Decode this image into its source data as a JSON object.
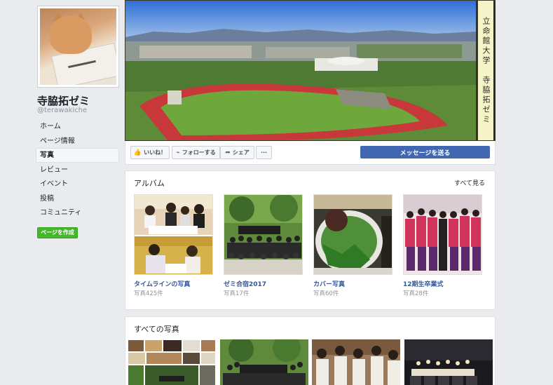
{
  "profile": {
    "name": "寺脇拓ゼミ",
    "handle": "@terawakiche"
  },
  "sidebar": {
    "items": [
      {
        "label": "ホーム",
        "active": false
      },
      {
        "label": "ページ情報",
        "active": false
      },
      {
        "label": "写真",
        "active": true
      },
      {
        "label": "レビュー",
        "active": false
      },
      {
        "label": "イベント",
        "active": false
      },
      {
        "label": "投稿",
        "active": false
      },
      {
        "label": "コミュニティ",
        "active": false
      }
    ],
    "create_page_label": "ページを作成"
  },
  "cover": {
    "sign_text": "立命館大学　寺脇拓ゼミ"
  },
  "actions": {
    "like_label": "いいね！",
    "follow_label": "フォローする",
    "share_label": "シェア",
    "more_label": "···",
    "message_label": "メッセージを送る"
  },
  "albums_section": {
    "title": "アルバム",
    "see_all": "すべて見る",
    "albums": [
      {
        "name": "タイムラインの写真",
        "count": "写真425件"
      },
      {
        "name": "ゼミ合宿2017",
        "count": "写真17件"
      },
      {
        "name": "カバー写真",
        "count": "写真60件"
      },
      {
        "name": "12期生卒業式",
        "count": "写真28件"
      }
    ]
  },
  "photos_section": {
    "title": "すべての写真"
  },
  "colors": {
    "page_bg": "#e9ebee",
    "link": "#365899",
    "primary": "#4267b2",
    "create": "#42b72a"
  }
}
